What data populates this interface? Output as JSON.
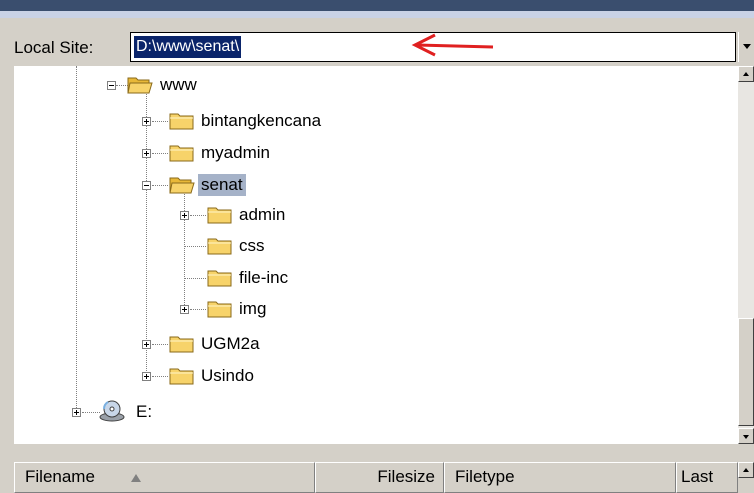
{
  "local_site": {
    "label": "Local Site:",
    "path": "D:\\www\\senat\\"
  },
  "tree": [
    {
      "label": "www",
      "expander": "minus",
      "icon": "open-folder-icon"
    },
    {
      "label": "bintangkencana",
      "expander": "plus",
      "icon": "folder-icon"
    },
    {
      "label": "myadmin",
      "expander": "plus",
      "icon": "folder-icon"
    },
    {
      "label": "senat",
      "expander": "minus",
      "icon": "open-folder-icon",
      "selected": true
    },
    {
      "label": "admin",
      "expander": "plus",
      "icon": "folder-icon"
    },
    {
      "label": "css",
      "expander": "none",
      "icon": "folder-icon"
    },
    {
      "label": "file-inc",
      "expander": "none",
      "icon": "folder-icon"
    },
    {
      "label": "img",
      "expander": "plus",
      "icon": "folder-icon"
    },
    {
      "label": "UGM2a",
      "expander": "plus",
      "icon": "folder-icon"
    },
    {
      "label": "Usindo",
      "expander": "plus",
      "icon": "folder-icon"
    },
    {
      "label": "E:",
      "expander": "plus",
      "icon": "drive-icon"
    }
  ],
  "columns": {
    "filename": "Filename",
    "filesize": "Filesize",
    "filetype": "Filetype",
    "last_modified": "Last Mo."
  },
  "colors": {
    "accent_arrow": "#e02020",
    "selection": "#a5b2c8",
    "folder": "#f7d36a"
  }
}
